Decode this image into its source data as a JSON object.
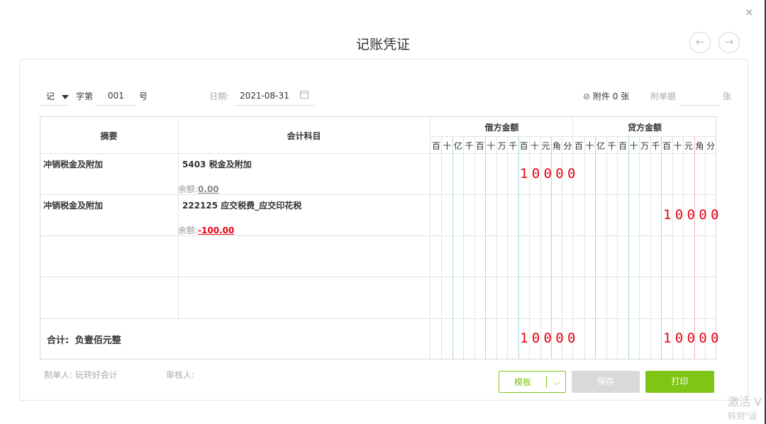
{
  "dialog": {
    "close_icon": "×",
    "title": "记账凭证",
    "prev_icon": "←",
    "next_icon": "→"
  },
  "voucher": {
    "type_value": "记",
    "word_label": "字第",
    "number_value": "001",
    "number_suffix": "号",
    "date_label": "日期:",
    "date_value": "2021-08-31",
    "attachment_label": "附件 0 张",
    "attached_docs_label": "附单据",
    "attached_docs_value": "",
    "sheet_unit": "张"
  },
  "table": {
    "col_summary": "摘要",
    "col_account": "会计科目",
    "col_debit": "借方金额",
    "col_credit": "贷方金额",
    "digit_units": [
      "百",
      "十",
      "亿",
      "千",
      "百",
      "十",
      "万",
      "千",
      "百",
      "十",
      "元",
      "角",
      "分"
    ],
    "rows": [
      {
        "summary": "冲销税金及附加",
        "account": "5403 税金及附加",
        "balance_label": "余额:",
        "balance_value": "0.00",
        "debit": "10000",
        "credit": ""
      },
      {
        "summary": "冲销税金及附加",
        "account": "222125 应交税费_应交印花税",
        "balance_label": "余额:",
        "balance_value": "-100.00",
        "debit": "",
        "credit": "10000"
      },
      {
        "summary": "",
        "account": "",
        "balance_label": "",
        "balance_value": "",
        "debit": "",
        "credit": ""
      },
      {
        "summary": "",
        "account": "",
        "balance_label": "",
        "balance_value": "",
        "debit": "",
        "credit": ""
      }
    ],
    "total_label": "合计:",
    "total_words": "负壹佰元整",
    "total_debit": "10000",
    "total_credit": "10000"
  },
  "footer": {
    "preparer": "制单人: 玩转好会计",
    "reviewer": "审核人:",
    "template_label": "模板",
    "save_label": "保存",
    "print_label": "打印"
  },
  "watermark": {
    "line1": "激活 V",
    "line2": "转到\"设"
  },
  "colors": {
    "amount_red": "#e60012",
    "accent_green": "#7dc614",
    "disabled_gray": "#d9d9d9",
    "grid_line": "#e3e3e3",
    "line_blue": "#aad4ea",
    "line_red": "#f0b7b7"
  }
}
